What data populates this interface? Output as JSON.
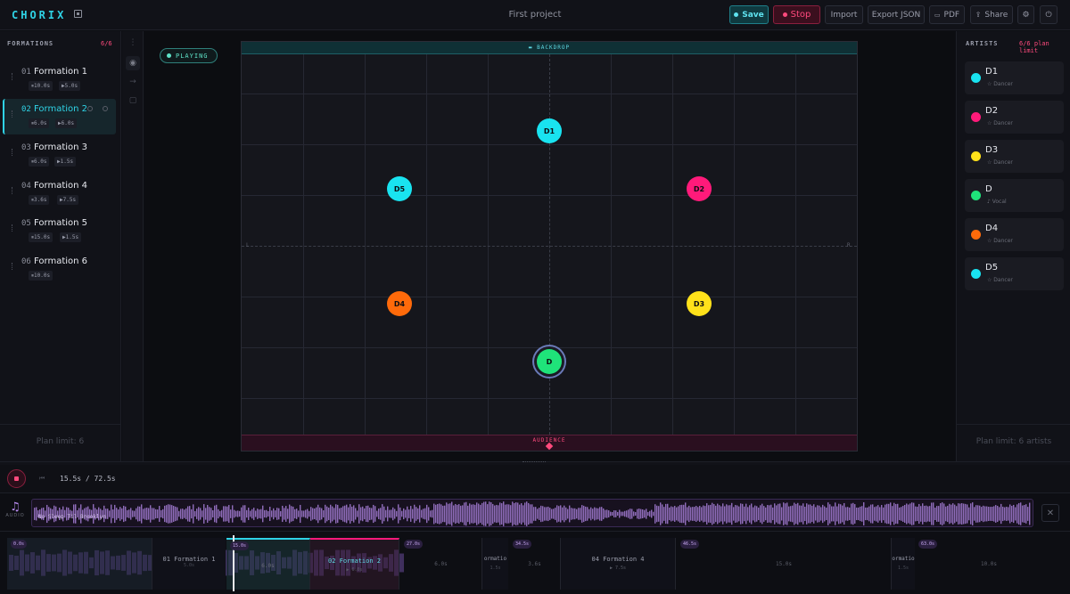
{
  "app": {
    "logo": "CHORIX",
    "project_title": "First project"
  },
  "toolbar": {
    "save": "Save",
    "stop": "Stop",
    "import": "Import",
    "export": "Export JSON",
    "pdf": "PDF",
    "share": "Share",
    "icons": [
      "save-dot-icon",
      "stop-dot-icon",
      "pdf-icon",
      "share-icon",
      "settings-icon",
      "power-icon"
    ]
  },
  "formations": {
    "heading": "FORMATIONS",
    "count": "6/6",
    "plan_limit": "Plan limit: 6",
    "items": [
      {
        "num": "01",
        "name": "Formation 1",
        "hold": "10.0s",
        "trans": "5.0s"
      },
      {
        "num": "02",
        "name": "Formation 2",
        "hold": "6.0s",
        "trans": "6.0s"
      },
      {
        "num": "03",
        "name": "Formation 3",
        "hold": "6.0s",
        "trans": "1.5s"
      },
      {
        "num": "04",
        "name": "Formation 4",
        "hold": "3.6s",
        "trans": "7.5s"
      },
      {
        "num": "05",
        "name": "Formation 5",
        "hold": "15.0s",
        "trans": "1.5s"
      },
      {
        "num": "06",
        "name": "Formation 6",
        "hold": "10.0s",
        "trans": ""
      }
    ]
  },
  "stage": {
    "status": "PLAYING",
    "backdrop": "BACKDROP",
    "audience": "AUDIENCE",
    "left_label": "L",
    "right_label": "R",
    "dancers": [
      {
        "label": "D1",
        "color": "#19e3f0"
      },
      {
        "label": "D5",
        "color": "#19e3f0"
      },
      {
        "label": "D2",
        "color": "#ff1a7a"
      },
      {
        "label": "D4",
        "color": "#ff6a0a"
      },
      {
        "label": "D3",
        "color": "#ffe11a"
      },
      {
        "label": "D",
        "color": "#1fe37a"
      }
    ]
  },
  "artists": {
    "heading": "ARTISTS",
    "count": "6/6 plan limit",
    "plan_limit": "Plan limit: 6 artists",
    "items": [
      {
        "name": "D1",
        "role": "Dancer",
        "color": "#19e3f0"
      },
      {
        "name": "D2",
        "role": "Dancer",
        "color": "#ff1a7a"
      },
      {
        "name": "D3",
        "role": "Dancer",
        "color": "#ffe11a"
      },
      {
        "name": "D",
        "role": "Vocal",
        "color": "#1fe37a"
      },
      {
        "name": "D4",
        "role": "Dancer",
        "color": "#ff6a0a"
      },
      {
        "name": "D5",
        "role": "Dancer",
        "color": "#19e3f0"
      }
    ]
  },
  "transport": {
    "timecode": "15.5s / 72.5s"
  },
  "audio": {
    "label": "AUDIO",
    "title": "No Sleep Til Brooklyn",
    "accent": "#b98cf0"
  },
  "timeline": {
    "segments": [
      {
        "start": "0.0s",
        "label": "01 Formation 1",
        "sub": ""
      },
      {
        "start": "15.0s",
        "label": "02 Formation 2",
        "sub": "6.0s"
      },
      {
        "start": "27.0s",
        "label": "",
        "sub": ""
      },
      {
        "start": "34.5s",
        "label": "ormatio",
        "sub": "3.6s"
      },
      {
        "start": "46.5s",
        "label": "",
        "sub": ""
      },
      {
        "start": "63.0s",
        "label": "ormatio",
        "sub": ""
      }
    ],
    "transitions": [
      "6.0s",
      "6.0s",
      "1.5s",
      "7.5s",
      "15.0s",
      "1.5s",
      "10.0s"
    ],
    "formation4": {
      "label": "04 Formation 4",
      "sub": "7.5s"
    },
    "extra_labels": [
      "5.0s",
      "6.0s",
      "1.5s",
      "1.5s",
      "10.0s"
    ]
  }
}
